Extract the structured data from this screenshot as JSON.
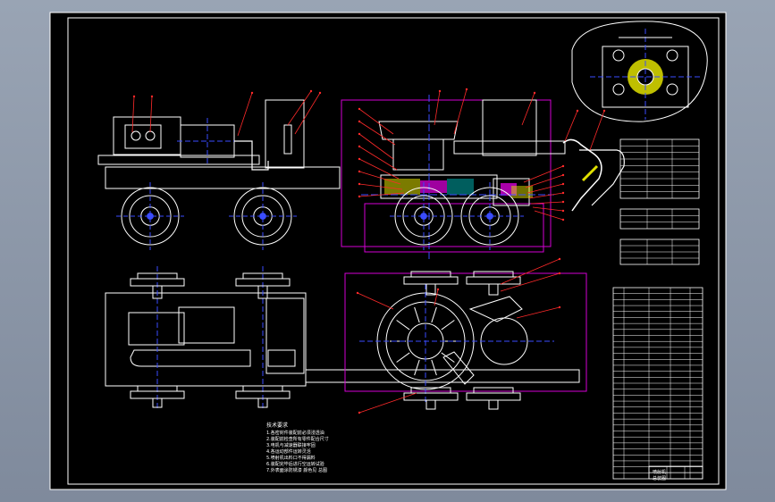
{
  "drawing": {
    "background": "#000000",
    "frame_color": "#ffffff",
    "colors": {
      "outline": "#ffffff",
      "center_line": "#3a4cff",
      "section": "#d400d4",
      "leader": "#ff2a2a",
      "hatch": "#e0e000",
      "cyan": "#00d0d0",
      "green": "#20c040"
    }
  },
  "notes": {
    "title": "技术要求",
    "lines": [
      "1.各密封件装配前必须浸透油",
      "2.装配前检查所有零件配合尺寸",
      "3.电机与减速器联接牢固",
      "4.各运动部件运转灵活",
      "5.喷射机出料口不得漏料",
      "6.装配完毕后进行空运转试验",
      "7.外表面涂防锈漆 颜色见 总图"
    ]
  },
  "title_block": {
    "label_a": "喷射机",
    "label_b": "总装图"
  }
}
